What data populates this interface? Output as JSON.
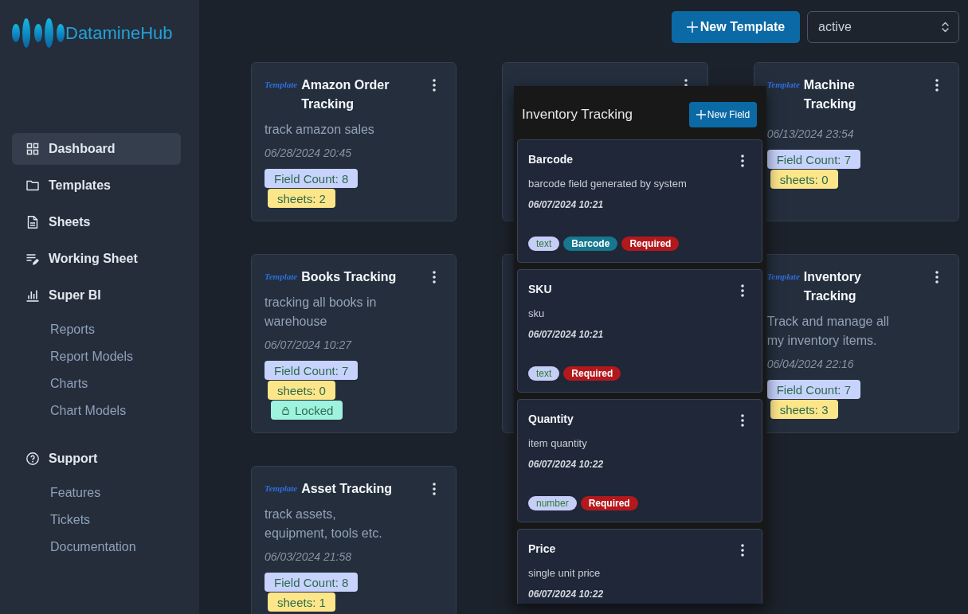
{
  "sidebar": {
    "logo": "DatamineHub",
    "nav": [
      {
        "label": "Dashboard",
        "selected": true
      },
      {
        "label": "Templates",
        "selected": false
      },
      {
        "label": "Sheets",
        "selected": false
      },
      {
        "label": "Working Sheet",
        "selected": false
      },
      {
        "label": "Super BI",
        "selected": false,
        "children": [
          {
            "label": "Reports",
            "selected": false
          },
          {
            "label": "Report Models",
            "selected": false
          },
          {
            "label": "Charts",
            "selected": false
          },
          {
            "label": "Chart Models",
            "selected": false
          }
        ]
      },
      {
        "label": "Support",
        "selected": false,
        "children": [
          {
            "label": "Features",
            "selected": false
          },
          {
            "label": "Tickets",
            "selected": false
          },
          {
            "label": "Documentation",
            "selected": false
          }
        ]
      }
    ]
  },
  "toolbar": {
    "new_button": "New Template",
    "status_select": {
      "value": "active"
    }
  },
  "templates": [
    {
      "kind": "template",
      "logo": "Template",
      "title": "Amazon Order Tracking",
      "description": "track amazon sales",
      "date": "06/28/2024 20:45",
      "badges": [
        {
          "kind": "count",
          "text": "Field Count: 8"
        },
        {
          "kind": "sheets",
          "text": "sheets: 2"
        }
      ]
    },
    {
      "kind": "template"
    },
    {
      "kind": "template",
      "logo": "Template",
      "title": "Machine Tracking",
      "date": "06/13/2024 23:54",
      "badges": [
        {
          "kind": "count",
          "text": "Field Count: 7"
        },
        {
          "kind": "sheets",
          "text": "sheets: 0"
        }
      ]
    },
    {
      "kind": "template",
      "logo": "Template",
      "title": "Books Tracking",
      "description": "tracking all books in warehouse",
      "date": "06/07/2024 10:27",
      "badges": [
        {
          "kind": "count",
          "text": "Field Count: 7"
        },
        {
          "kind": "sheets",
          "text": "sheets: 0"
        },
        {
          "kind": "locked",
          "text": "Locked"
        }
      ]
    },
    {
      "kind": "blank"
    },
    {
      "kind": "template",
      "logo": "Template",
      "title": "Inventory Tracking",
      "description": "Track and manage all my inventory items.",
      "date": "06/04/2024 22:16",
      "badges": [
        {
          "kind": "count",
          "text": "Field Count: 7"
        },
        {
          "kind": "sheets",
          "text": "sheets: 3"
        }
      ]
    },
    {
      "kind": "template",
      "logo": "Template",
      "title": "Asset Tracking",
      "description": "track assets, equipment, tools etc.",
      "date": "06/03/2024 21:58",
      "badges": [
        {
          "kind": "count",
          "text": "Field Count: 8"
        },
        {
          "kind": "sheets",
          "text": "sheets: 1"
        }
      ]
    }
  ],
  "field_panel": {
    "title": "Inventory Tracking",
    "new_button": "New Field",
    "fields": [
      {
        "name": "Barcode",
        "description": "barcode field generated by system",
        "date": "06/07/2024 10:21",
        "tags": [
          {
            "kind": "type",
            "text": "text"
          },
          {
            "kind": "barcode",
            "text": "Barcode"
          },
          {
            "kind": "required",
            "text": "Required"
          }
        ]
      },
      {
        "name": "SKU",
        "description": "sku",
        "date": "06/07/2024 10:21",
        "tags": [
          {
            "kind": "type",
            "text": "text"
          },
          {
            "kind": "required",
            "text": "Required"
          }
        ]
      },
      {
        "name": "Quantity",
        "description": "item quantity",
        "date": "06/07/2024 10:22",
        "tags": [
          {
            "kind": "type",
            "text": "number"
          },
          {
            "kind": "required",
            "text": "Required"
          }
        ]
      },
      {
        "name": "Price",
        "description": "single unit price",
        "date": "06/07/2024 10:22"
      }
    ]
  }
}
